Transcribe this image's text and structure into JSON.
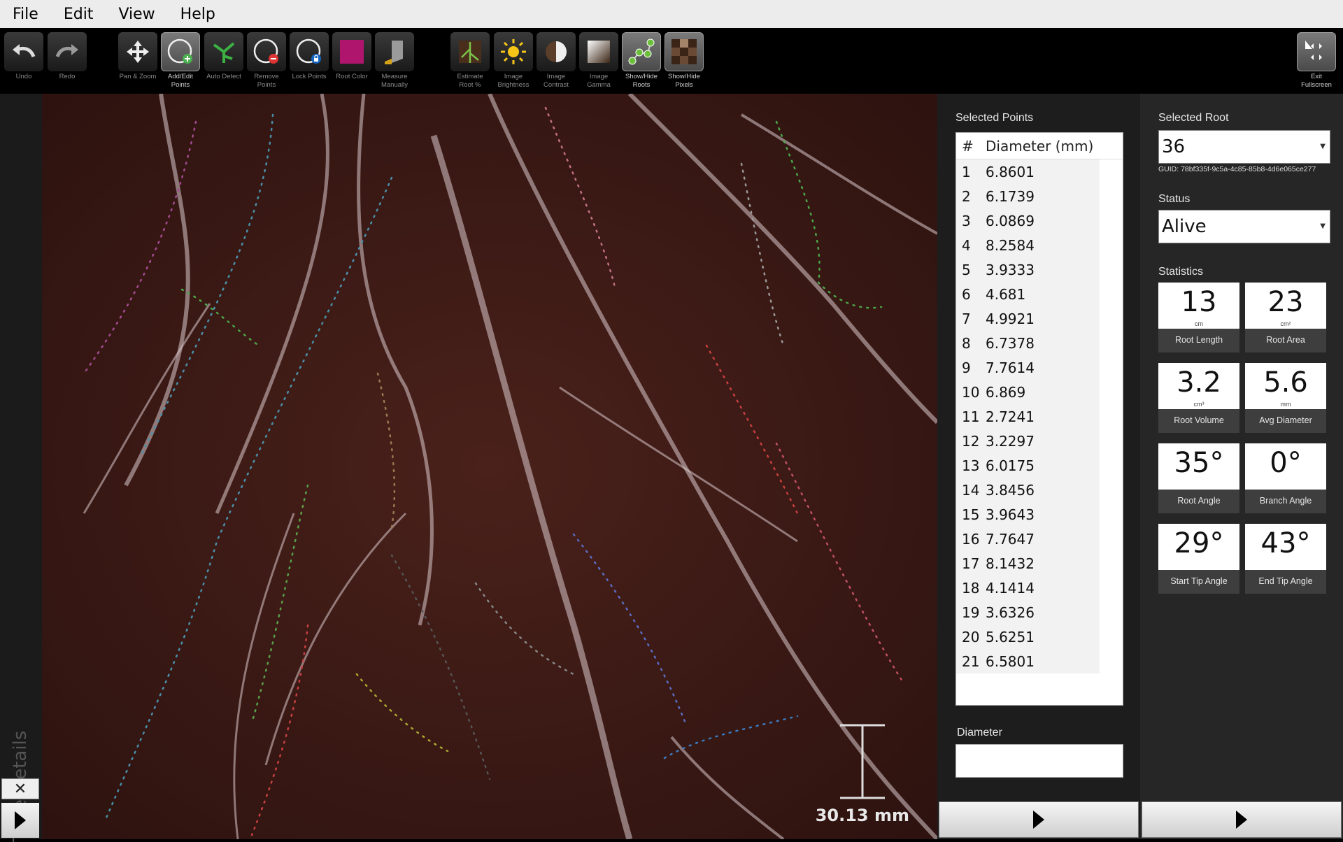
{
  "menu": [
    "File",
    "Edit",
    "View",
    "Help"
  ],
  "toolbar": {
    "undo": "Undo",
    "redo": "Redo",
    "pan_zoom": "Pan & Zoom",
    "add_edit_points": "Add/Edit\nPoints",
    "auto_detect": "Auto Detect",
    "remove_points": "Remove\nPoints",
    "lock_points": "Lock Points",
    "root_color": "Root Color",
    "measure_manually": "Measure\nManually",
    "estimate_root": "Estimate\nRoot %",
    "image_brightness": "Image\nBrightness",
    "image_contrast": "Image\nContrast",
    "image_gamma": "Image\nGamma",
    "show_hide_roots": "Show/Hide\nRoots",
    "show_hide_pixels": "Show/Hide\nPixels",
    "exit_fullscreen": "Exit\nFullscreen",
    "root_color_value": "#b0156e"
  },
  "tube_details": "Tube Details",
  "close_symbol": "✕",
  "scale_label": "30.13 mm",
  "selected_points": {
    "title": "Selected Points",
    "col_num": "#",
    "col_diam": "Diameter (mm)",
    "rows": [
      [
        "1",
        "6.8601"
      ],
      [
        "2",
        "6.1739"
      ],
      [
        "3",
        "6.0869"
      ],
      [
        "4",
        "8.2584"
      ],
      [
        "5",
        "3.9333"
      ],
      [
        "6",
        "4.681"
      ],
      [
        "7",
        "4.9921"
      ],
      [
        "8",
        "6.7378"
      ],
      [
        "9",
        "7.7614"
      ],
      [
        "10",
        "6.869"
      ],
      [
        "11",
        "2.7241"
      ],
      [
        "12",
        "3.2297"
      ],
      [
        "13",
        "6.0175"
      ],
      [
        "14",
        "3.8456"
      ],
      [
        "15",
        "3.9643"
      ],
      [
        "16",
        "7.7647"
      ],
      [
        "17",
        "8.1432"
      ],
      [
        "18",
        "4.1414"
      ],
      [
        "19",
        "3.6326"
      ],
      [
        "20",
        "5.6251"
      ],
      [
        "21",
        "6.5801"
      ]
    ]
  },
  "diameter_label": "Diameter",
  "diameter_value": "",
  "selected_root": {
    "title": "Selected Root",
    "value": "36",
    "guid": "GUID: 78bf335f-9c5a-4c85-85b8-4d6e065ce277"
  },
  "status": {
    "title": "Status",
    "value": "Alive"
  },
  "statistics": {
    "title": "Statistics",
    "root_length": {
      "value": "13",
      "unit": "cm",
      "label": "Root Length"
    },
    "root_area": {
      "value": "23",
      "unit": "cm²",
      "label": "Root Area"
    },
    "root_volume": {
      "value": "3.2",
      "unit": "cm³",
      "label": "Root Volume"
    },
    "avg_diameter": {
      "value": "5.6",
      "unit": "mm",
      "label": "Avg Diameter"
    },
    "root_angle": {
      "value": "35°",
      "unit": "",
      "label": "Root Angle"
    },
    "branch_angle": {
      "value": "0°",
      "unit": "",
      "label": "Branch Angle"
    },
    "start_tip_angle": {
      "value": "29°",
      "unit": "",
      "label": "Start Tip Angle"
    },
    "end_tip_angle": {
      "value": "43°",
      "unit": "",
      "label": "End Tip Angle"
    }
  }
}
